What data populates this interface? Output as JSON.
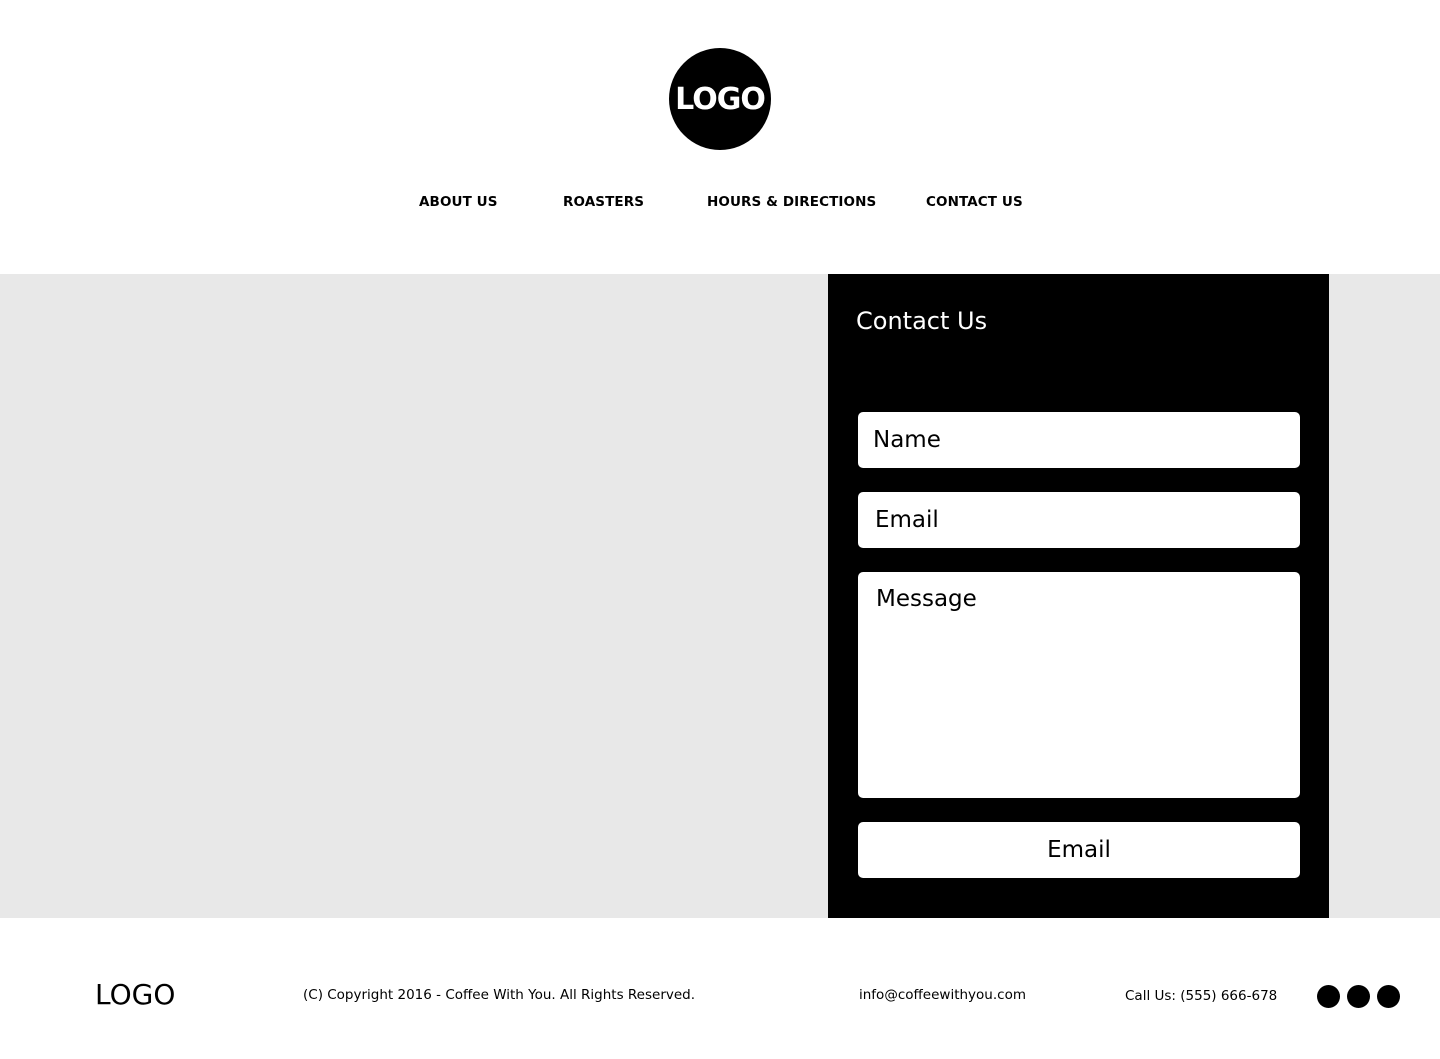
{
  "header": {
    "logo_text": "LOGO",
    "nav": [
      {
        "label": "ABOUT US"
      },
      {
        "label": "ROASTERS"
      },
      {
        "label": "HOURS & DIRECTIONS"
      },
      {
        "label": "CONTACT US"
      }
    ]
  },
  "contact_form": {
    "title": "Contact Us",
    "name_placeholder": "Name",
    "email_placeholder": "Email",
    "message_placeholder": "Message",
    "submit_label": "Email"
  },
  "footer": {
    "logo_text": "LOGO",
    "copyright": "(C) Copyright 2016 - Coffee With You. All Rights Reserved.",
    "email": "info@coffeewithyou.com",
    "phone": "Call Us: (555) 666-678",
    "social_icons": [
      "social-icon-1",
      "social-icon-2",
      "social-icon-3"
    ]
  },
  "colors": {
    "background": "#ffffff",
    "band": "#e8e8e8",
    "panel": "#000000"
  }
}
